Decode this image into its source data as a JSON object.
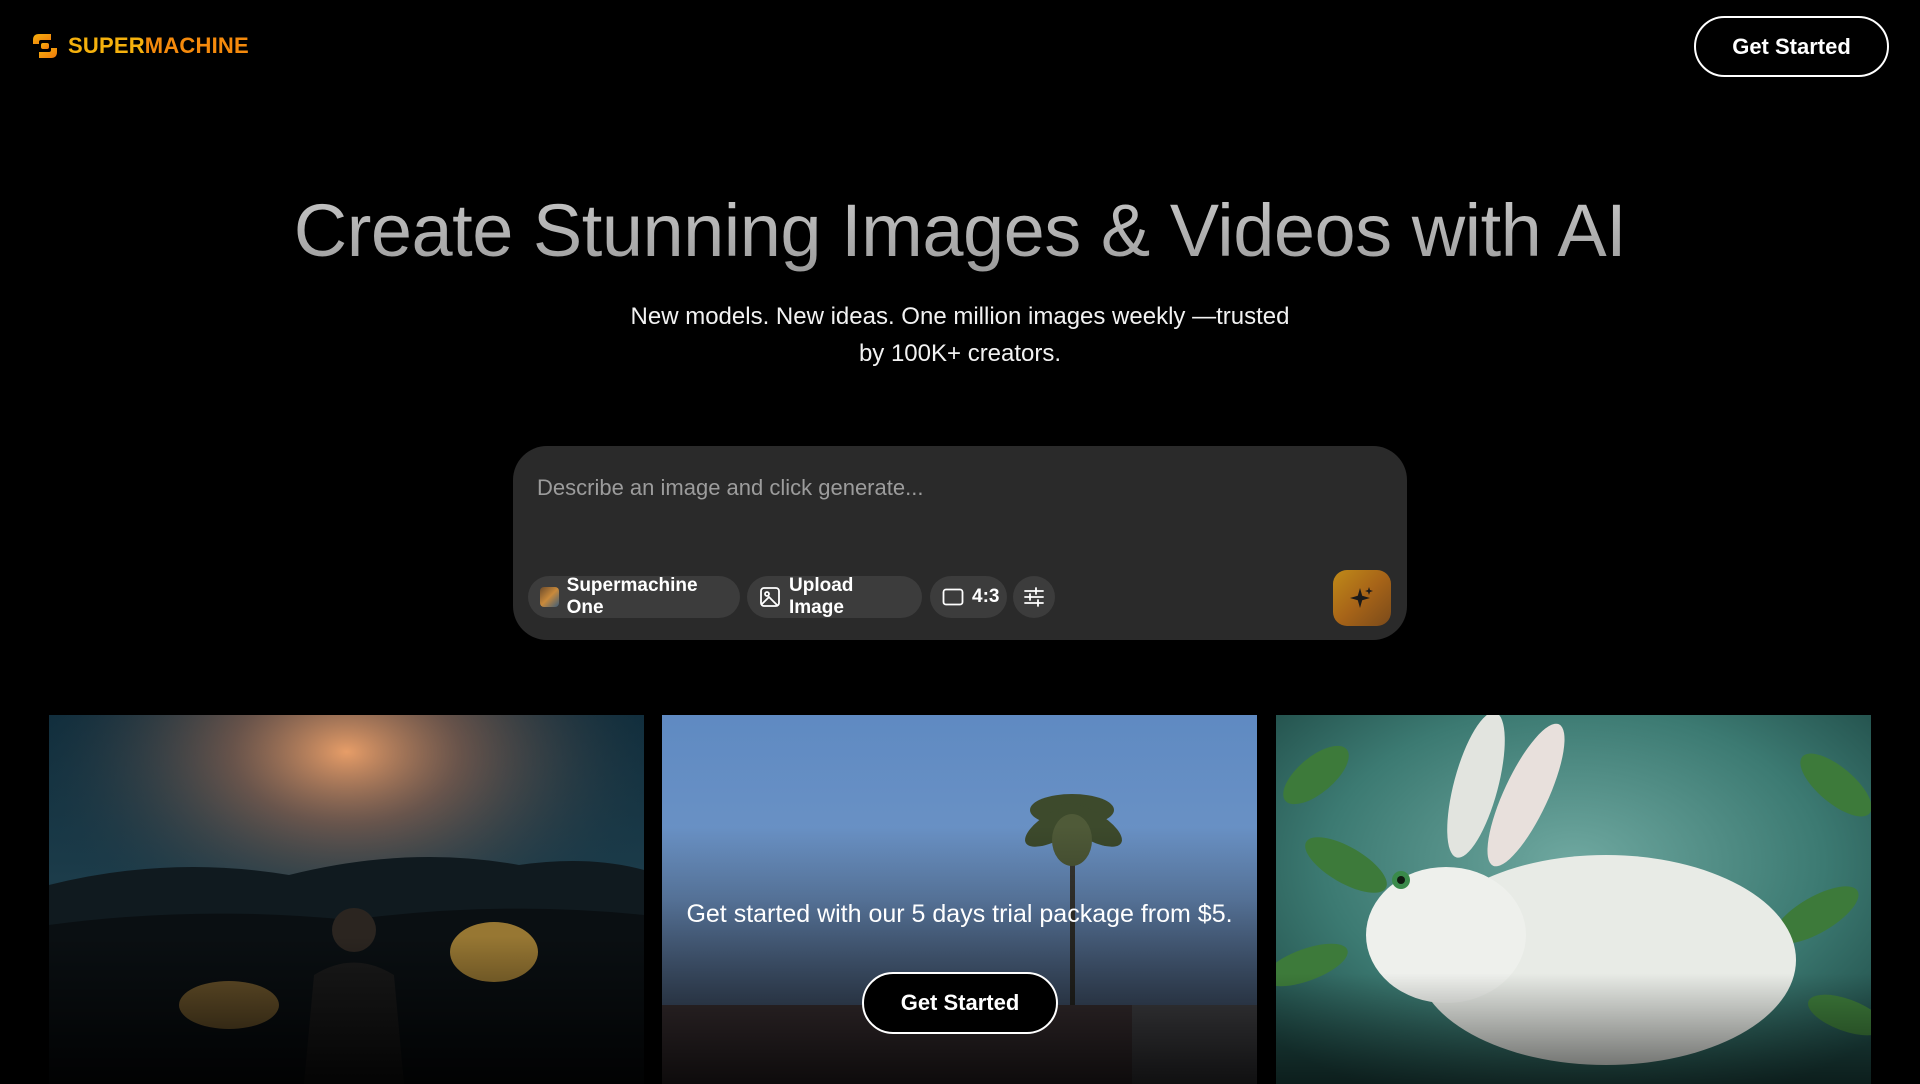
{
  "brand": {
    "name_part1": "SUPER",
    "name_part2": "MACHINE",
    "color_primary": "#f5b10d",
    "color_secondary": "#f58a0c"
  },
  "header": {
    "cta_label": "Get Started"
  },
  "hero": {
    "title": "Create Stunning Images & Videos with AI",
    "subtitle_line1": "New models. New ideas. One million images weekly —trusted",
    "subtitle_line2": "by 100K+ creators."
  },
  "prompt": {
    "placeholder": "Describe an image and click generate...",
    "model_label": "Supermachine One",
    "upload_label": "Upload Image",
    "ratio_label": "4:3",
    "settings_icon": "sliders-icon",
    "generate_icon": "sparkles-icon"
  },
  "gallery": {
    "cards": [
      {
        "name": "drummer-image"
      },
      {
        "name": "palm-tree-trial-card"
      },
      {
        "name": "white-rabbit-image"
      }
    ],
    "trial_text": "Get started with our 5 days trial package from $5.",
    "trial_cta": "Get Started"
  }
}
